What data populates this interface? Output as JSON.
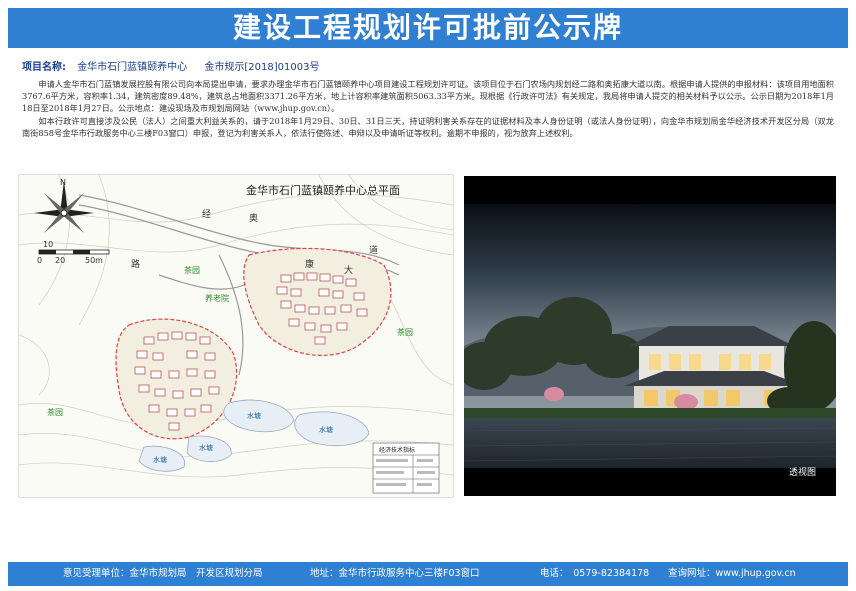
{
  "header": {
    "title": "建设工程规划许可批前公示牌"
  },
  "project": {
    "name_label": "项目名称:",
    "name_value": "金华市石门蓝镇颐养中心",
    "code_value": "金市规示[2018]01003号"
  },
  "notice": {
    "para1": "申请人金华市石门蓝镇发展控股有限公司向本局提出申请，要求办理金华市石门蓝镇颐养中心项目建设工程规划许可证。该项目位于石门农场内规划经二路和奥拓康大道以南。根据申请人提供的申报材料：该项目用地面积3767.6平方米，容积率1.34，建筑密度89.48%，建筑总占地面积3371.26平方米，地上计容积率建筑面积5063.33平方米。现根据《行政许可法》有关规定，我局将申请人提交的相关材料予以公示。公示日期为2018年1月18日至2018年1月27日。公示地点：建设现场及市规划局网站（www.jhup.gov.cn）。",
    "para2": "如本行政许可直接涉及公民（法人）之间重大利益关系的，请于2018年1月29日、30日、31日三天，持证明利害关系存在的证据材料及本人身份证明（或法人身份证明），向金华市规划局金华经济技术开发区分局（双龙南街858号金华市行政服务中心三楼F03窗口）申报，登记为利害关系人，依法行使陈述、申辩以及申请听证等权利。逾期不申报的，视为放弃上述权利。"
  },
  "site_plan": {
    "title": "金华市石门蓝镇颐养中心总平面",
    "north": "N",
    "scale_10": "10",
    "scale_0": "0",
    "scale_20": "20",
    "scale_50": "50m",
    "labels": {
      "road1": "经",
      "road2": "奥",
      "road3": "路",
      "road4": "康",
      "road5": "大",
      "road6": "道",
      "field1": "茶园",
      "field2": "茶园",
      "field3": "茶园",
      "field4": "养老院",
      "pond1": "水塘",
      "pond2": "水塘",
      "pond3": "水塘",
      "pond4": "水塘",
      "table_title": "经济技术指标"
    }
  },
  "rendering": {
    "caption": "透视图"
  },
  "footer": {
    "unit": "意见受理单位：金华市规划局　开发区规划分局",
    "address": "地址：金华市行政服务中心三楼F03窗口",
    "phone": "电话：　0579-82384178",
    "website": "查询网址：www.jhup.gov.cn"
  },
  "colors": {
    "banner": "#2f7fd2"
  }
}
